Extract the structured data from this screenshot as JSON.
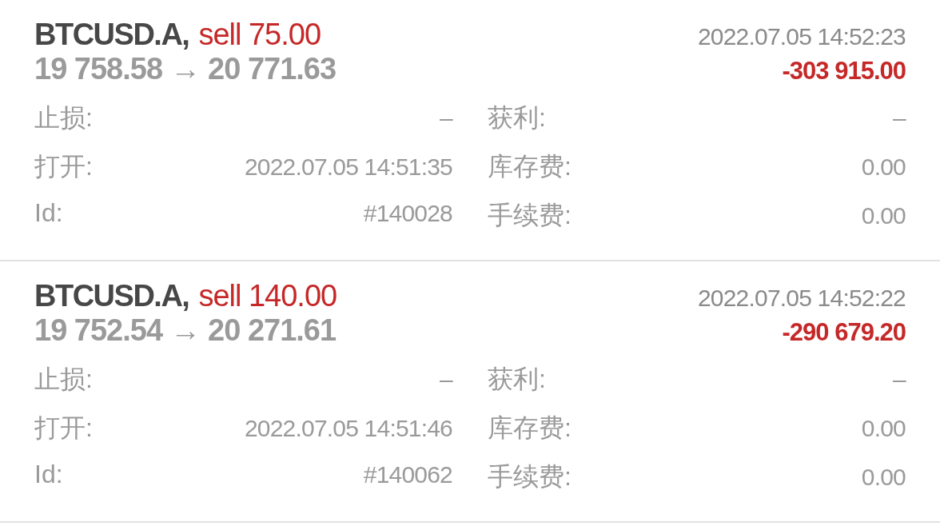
{
  "trades": [
    {
      "symbol": "BTCUSD.A,",
      "order": "sell 75.00",
      "time": "2022.07.05 14:52:23",
      "open_price": "19 758.58",
      "arrow": "→",
      "close_price": "20 771.63",
      "profit": "-303 915.00",
      "fields": [
        {
          "label": "止损:",
          "value": "–"
        },
        {
          "label": "获利:",
          "value": "–"
        },
        {
          "label": "打开:",
          "value": "2022.07.05 14:51:35"
        },
        {
          "label": "库存费:",
          "value": "0.00"
        },
        {
          "label": "Id:",
          "value": "#140028"
        },
        {
          "label": "手续费:",
          "value": "0.00"
        }
      ]
    },
    {
      "symbol": "BTCUSD.A,",
      "order": "sell 140.00",
      "time": "2022.07.05 14:52:22",
      "open_price": "19 752.54",
      "arrow": "→",
      "close_price": "20 271.61",
      "profit": "-290 679.20",
      "fields": [
        {
          "label": "止损:",
          "value": "–"
        },
        {
          "label": "获利:",
          "value": "–"
        },
        {
          "label": "打开:",
          "value": "2022.07.05 14:51:46"
        },
        {
          "label": "库存费:",
          "value": "0.00"
        },
        {
          "label": "Id:",
          "value": "#140062"
        },
        {
          "label": "手续费:",
          "value": "0.00"
        }
      ]
    }
  ]
}
